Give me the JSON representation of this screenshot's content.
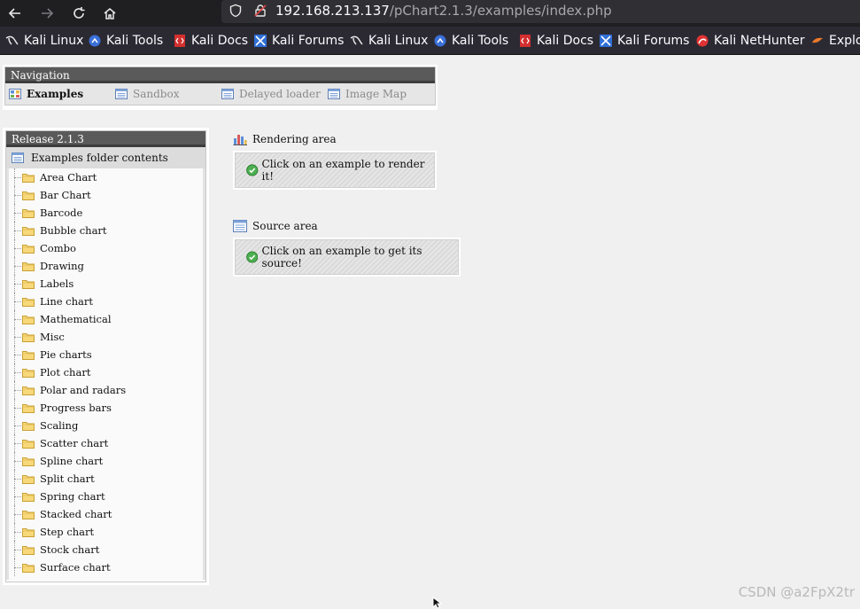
{
  "browser": {
    "url_host": "192.168.213.137",
    "url_path": "/pChart2.1.3/examples/index.php",
    "bookmarks": [
      {
        "label": "Kali Linux",
        "icon": "kali-dragon-icon"
      },
      {
        "label": "Kali Tools",
        "icon": "kali-tools-icon"
      },
      {
        "label": "Kali Docs",
        "icon": "kali-docs-icon"
      },
      {
        "label": "Kali Forums",
        "icon": "kali-forums-icon"
      },
      {
        "label": "Kali Linux",
        "icon": "kali-dragon-icon"
      },
      {
        "label": "Kali Tools",
        "icon": "kali-tools-icon"
      },
      {
        "label": "Kali Docs",
        "icon": "kali-docs-icon"
      },
      {
        "label": "Kali Forums",
        "icon": "kali-forums-icon"
      },
      {
        "label": "Kali NetHunter",
        "icon": "nethunter-icon"
      },
      {
        "label": "Exploit-DB",
        "icon": "exploit-db-icon"
      }
    ]
  },
  "navigation": {
    "title": "Navigation",
    "tabs": [
      {
        "label": "Examples",
        "active": true
      },
      {
        "label": "Sandbox",
        "active": false
      },
      {
        "label": "Delayed loader",
        "active": false
      },
      {
        "label": "Image Map",
        "active": false
      }
    ]
  },
  "release": {
    "title": "Release 2.1.3",
    "folder_heading": "Examples folder contents",
    "folders": [
      "Area Chart",
      "Bar Chart",
      "Barcode",
      "Bubble chart",
      "Combo",
      "Drawing",
      "Labels",
      "Line chart",
      "Mathematical",
      "Misc",
      "Pie charts",
      "Plot chart",
      "Polar and radars",
      "Progress bars",
      "Scaling",
      "Scatter chart",
      "Spline chart",
      "Split chart",
      "Spring chart",
      "Stacked chart",
      "Step chart",
      "Stock chart",
      "Surface chart"
    ]
  },
  "rendering": {
    "title": "Rendering area",
    "message": "Click on an example to render it!"
  },
  "source": {
    "title": "Source area",
    "message": "Click on an example to get its source!"
  },
  "watermark": "CSDN @a2FpX2tr"
}
